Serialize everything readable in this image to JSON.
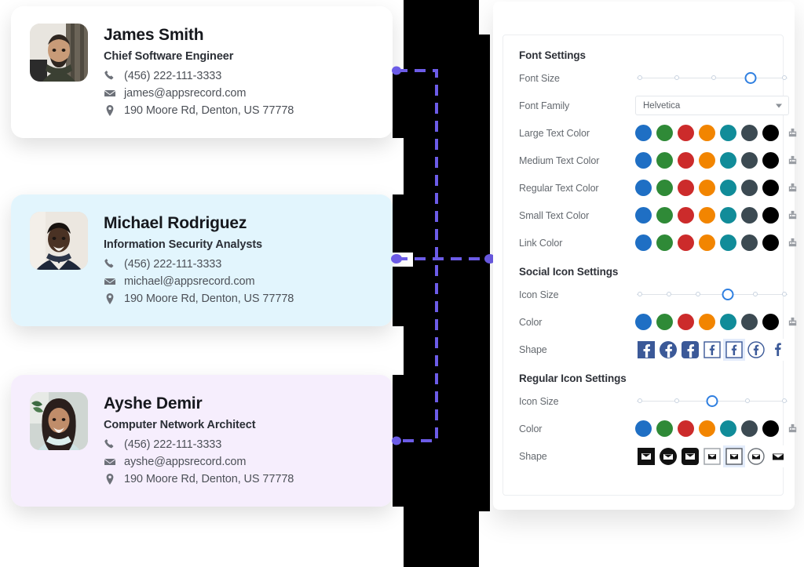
{
  "cards": [
    {
      "name": "James Smith",
      "title": "Chief Software Engineer",
      "phone": "(456) 222-111-3333",
      "email": "james@appsrecord.com",
      "address": "190 Moore Rd, Denton, US 77778",
      "bg": "#ffffff",
      "avatar_alt": "james-smith-avatar"
    },
    {
      "name": "Michael Rodriguez",
      "title": "Information Security Analysts",
      "phone": "(456) 222-111-3333",
      "email": "michael@appsrecord.com",
      "address": "190 Moore Rd, Denton, US 77778",
      "bg": "#e2f5fd",
      "avatar_alt": "michael-rodriguez-avatar"
    },
    {
      "name": "Ayshe Demir",
      "title": "Computer Network Architect",
      "phone": "(456) 222-111-3333",
      "email": "ayshe@appsrecord.com",
      "address": "190 Moore Rd, Denton, US 77778",
      "bg": "#f6eefd",
      "avatar_alt": "ayshe-demir-avatar"
    }
  ],
  "settings": {
    "font_section_title": "Font Settings",
    "font_size_label": "Font Size",
    "font_size_slider": {
      "ticks": 5,
      "selected_index": 4
    },
    "font_family_label": "Font Family",
    "font_family_value": "Helvetica",
    "color_rows": [
      {
        "label": "Large Text Color"
      },
      {
        "label": "Medium Text Color"
      },
      {
        "label": "Regular Text Color"
      },
      {
        "label": "Small Text Color"
      },
      {
        "label": "Link Color"
      }
    ],
    "palette": [
      "#1f6fc4",
      "#2f8a37",
      "#cc2b2b",
      "#f28500",
      "#118c99",
      "#3c4a52",
      "#000000"
    ],
    "picker_icon": "color-picker-icon",
    "social_section_title": "Social Icon Settings",
    "social_icon_size_label": "Icon Size",
    "social_icon_size_slider": {
      "ticks": 6,
      "selected_index": 4
    },
    "social_color_label": "Color",
    "social_shape_label": "Shape",
    "social_shapes": [
      "facebook-square-solid",
      "facebook-circle-solid",
      "facebook-rounded-solid",
      "facebook-square-outline",
      "facebook-square-outline-selected",
      "facebook-circle-outline",
      "facebook-letter-only"
    ],
    "social_shape_selected_index": 5,
    "regular_section_title": "Regular Icon Settings",
    "regular_icon_size_label": "Icon Size",
    "regular_icon_size_slider": {
      "ticks": 5,
      "selected_index": 3
    },
    "regular_color_label": "Color",
    "regular_shape_label": "Shape",
    "regular_shapes": [
      "mail-square-solid",
      "mail-circle-solid",
      "mail-rounded-solid",
      "mail-square-outline",
      "mail-square-outline-selected",
      "mail-circle-outline",
      "mail-glyph-only"
    ],
    "regular_shape_selected_index": 5
  },
  "connector": {
    "color": "#6c5ce7",
    "style": "dashed",
    "endpoint_count": 4
  }
}
